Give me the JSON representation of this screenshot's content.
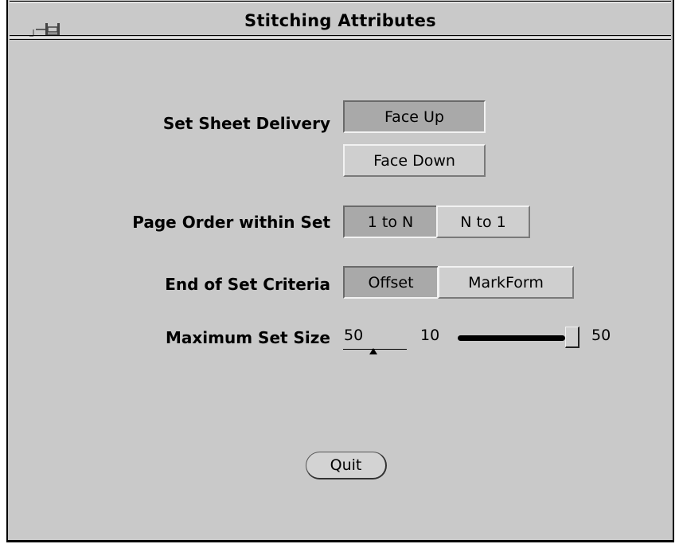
{
  "window": {
    "title": "Stitching Attributes",
    "menu_icon": "window-menu-pushpin-icon"
  },
  "sheet_delivery": {
    "label": "Set Sheet Delivery",
    "options": [
      "Face Up",
      "Face Down"
    ],
    "selected": "Face Up"
  },
  "page_order": {
    "label": "Page Order within Set",
    "options": [
      "1 to N",
      "N to 1"
    ],
    "selected": "1 to N"
  },
  "end_of_set": {
    "label": "End of Set Criteria",
    "options": [
      "Offset",
      "MarkForm"
    ],
    "selected": "Offset"
  },
  "max_set_size": {
    "label": "Maximum Set Size",
    "value": "50",
    "min_label": "10",
    "max_label": "50",
    "min": 10,
    "max": 50,
    "level": 50
  },
  "quit_label": "Quit"
}
